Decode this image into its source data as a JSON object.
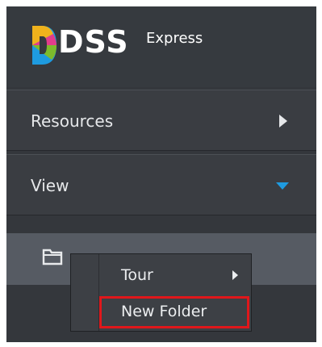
{
  "app": {
    "logo_text": "DSS",
    "logo_subtext": "Express"
  },
  "nav": {
    "resources_label": "Resources",
    "view_label": "View"
  },
  "context_menu": {
    "tour_label": "Tour",
    "new_folder_label": "New Folder"
  },
  "colors": {
    "panel_bg": "#34373c",
    "selected_row_bg": "#565b63",
    "accent_arrow": "#1e9be0",
    "highlight_border": "#e0171b"
  },
  "icons": {
    "resources_arrow": "chevron-right-icon",
    "view_arrow": "chevron-down-icon",
    "folder": "folder-icon",
    "tour_arrow": "chevron-right-icon"
  }
}
